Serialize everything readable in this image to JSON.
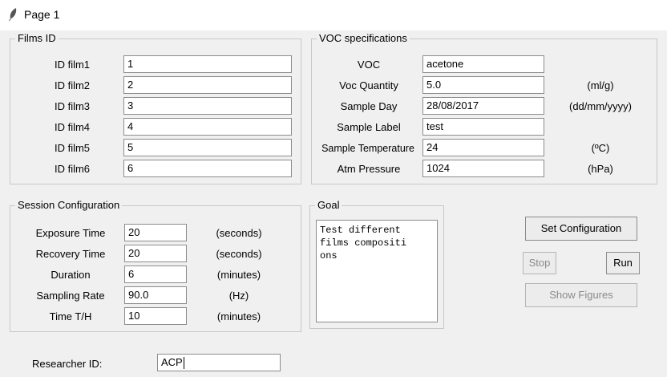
{
  "window": {
    "title": "Page 1"
  },
  "films": {
    "legend": "Films ID",
    "rows": [
      {
        "label": "ID film1",
        "value": "1"
      },
      {
        "label": "ID film2",
        "value": "2"
      },
      {
        "label": "ID film3",
        "value": "3"
      },
      {
        "label": "ID film4",
        "value": "4"
      },
      {
        "label": "ID film5",
        "value": "5"
      },
      {
        "label": "ID film6",
        "value": "6"
      }
    ]
  },
  "voc": {
    "legend": "VOC specifications",
    "rows": [
      {
        "label": "VOC",
        "value": "acetone",
        "unit": ""
      },
      {
        "label": "Voc Quantity",
        "value": "5.0",
        "unit": "(ml/g)"
      },
      {
        "label": "Sample Day",
        "value": "28/08/2017",
        "unit": "(dd/mm/yyyy)"
      },
      {
        "label": "Sample Label",
        "value": "test",
        "unit": ""
      },
      {
        "label": "Sample Temperature",
        "value": "24",
        "unit": "(ºC)"
      },
      {
        "label": "Atm Pressure",
        "value": "1024",
        "unit": "(hPa)"
      }
    ]
  },
  "session": {
    "legend": "Session Configuration",
    "rows": [
      {
        "label": "Exposure Time",
        "value": "20",
        "unit": "(seconds)"
      },
      {
        "label": "Recovery Time",
        "value": "20",
        "unit": "(seconds)"
      },
      {
        "label": "Duration",
        "value": "6",
        "unit": "(minutes)"
      },
      {
        "label": "Sampling Rate",
        "value": "90.0",
        "unit": "(Hz)"
      },
      {
        "label": "Time T/H",
        "value": "10",
        "unit": "(minutes)"
      }
    ]
  },
  "goal": {
    "legend": "Goal",
    "text": "Test different\nfilms compositi\nons"
  },
  "buttons": {
    "set_configuration": "Set Configuration",
    "stop": "Stop",
    "run": "Run",
    "show_figures": "Show Figures"
  },
  "researcher": {
    "label": "Researcher ID:",
    "value": "ACP"
  }
}
